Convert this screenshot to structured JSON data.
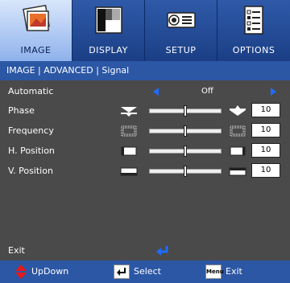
{
  "tabs": [
    {
      "label": "IMAGE",
      "icon": "image-icon",
      "active": true
    },
    {
      "label": "DISPLAY",
      "icon": "display-icon",
      "active": false
    },
    {
      "label": "SETUP",
      "icon": "projector-icon",
      "active": false
    },
    {
      "label": "OPTIONS",
      "icon": "options-icon",
      "active": false
    }
  ],
  "breadcrumb": "IMAGE | ADVANCED | Signal",
  "automatic": {
    "label": "Automatic",
    "value": "Off"
  },
  "settings": [
    {
      "label": "Phase",
      "value": "10",
      "level": 0.5
    },
    {
      "label": "Frequency",
      "value": "10",
      "level": 0.5
    },
    {
      "label": "H. Position",
      "value": "10",
      "level": 0.5
    },
    {
      "label": "V. Position",
      "value": "10",
      "level": 0.5
    }
  ],
  "exit": {
    "label": "Exit"
  },
  "footer": {
    "updown": "UpDown",
    "select": "Select",
    "menu_key": "Menu",
    "exit": "Exit"
  },
  "colors": {
    "accent_blue": "#2b57a5",
    "arrow_blue": "#1e6cff",
    "updown_red": "#e21b1b"
  }
}
